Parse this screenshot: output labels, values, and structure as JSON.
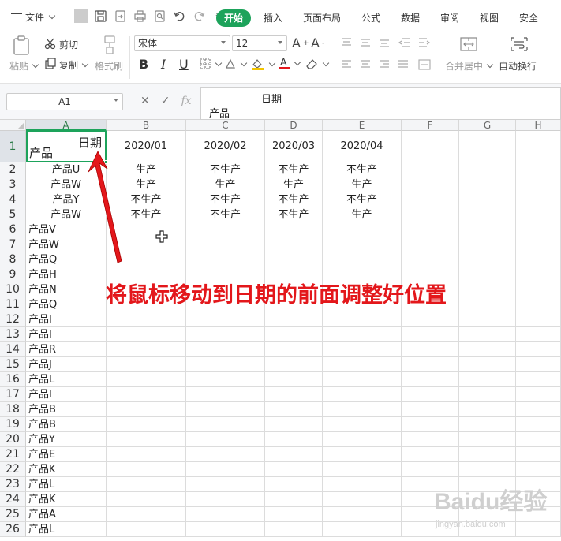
{
  "menubar": {
    "file_label": "文件",
    "tabs": [
      "开始",
      "插入",
      "页面布局",
      "公式",
      "数据",
      "审阅",
      "视图",
      "安全"
    ],
    "active_tab": "开始",
    "accent_color": "#1da35b"
  },
  "ribbon": {
    "paste_label": "粘贴",
    "cut_label": "剪切",
    "copy_label": "复制",
    "format_painter_label": "格式刷",
    "font_name": "宋体",
    "font_size": "12",
    "merge_label": "合并居中",
    "wrap_label": "自动换行"
  },
  "formula_bar": {
    "cell_ref": "A1",
    "fx_label": "fx",
    "content_line1": "日期",
    "content_line2": "产品"
  },
  "sheet": {
    "columns": [
      "A",
      "B",
      "C",
      "D",
      "E",
      "F",
      "G",
      "H"
    ],
    "selected_column": "A",
    "rows": [
      "1",
      "2",
      "3",
      "4",
      "5",
      "6",
      "7",
      "8",
      "9",
      "10",
      "11",
      "12",
      "13",
      "14",
      "15",
      "16",
      "17",
      "18",
      "19",
      "20",
      "21",
      "22",
      "23",
      "24",
      "25",
      "26"
    ],
    "a1_top": "日期",
    "a1_bottom": "产品",
    "header_dates": [
      "2020/01",
      "2020/02",
      "2020/03",
      "2020/04"
    ],
    "table_rows": [
      [
        "产品U",
        "生产",
        "不生产",
        "不生产",
        "不生产"
      ],
      [
        "产品W",
        "生产",
        "生产",
        "生产",
        "生产"
      ],
      [
        "产品Y",
        "不生产",
        "不生产",
        "不生产",
        "不生产"
      ],
      [
        "产品W",
        "不生产",
        "不生产",
        "不生产",
        "生产"
      ]
    ],
    "column_a_items": [
      "产品V",
      "产品W",
      "产品Q",
      "产品H",
      "产品N",
      "产品Q",
      "产品I",
      "产品I",
      "产品R",
      "产品J",
      "产品L",
      "产品I",
      "产品B",
      "产品B",
      "产品Y",
      "产品E",
      "产品K",
      "产品L",
      "产品K",
      "产品A",
      "产品L"
    ]
  },
  "annotation": {
    "text": "将鼠标移动到日期的前面调整好位置",
    "color": "#e3171b"
  },
  "watermark": {
    "text": "Baidu经验",
    "subtext": "jingyan.baidu.com"
  }
}
